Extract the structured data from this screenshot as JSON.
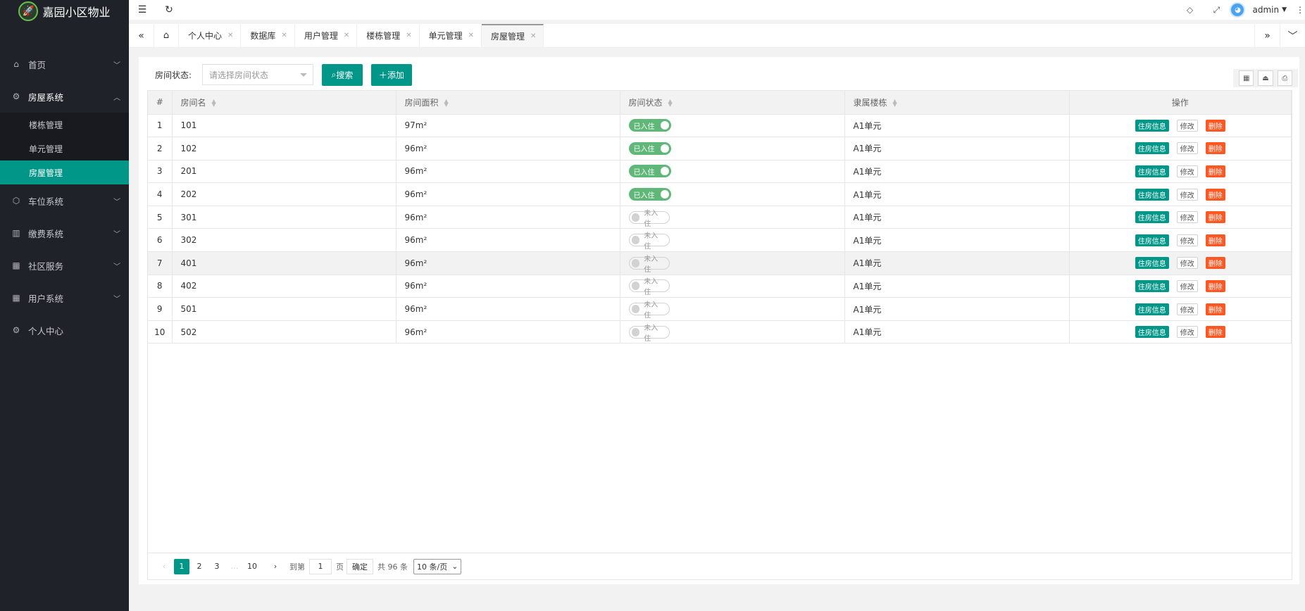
{
  "app": {
    "title": "嘉园小区物业"
  },
  "sidebar": {
    "items": [
      {
        "label": "首页",
        "icon": "home-icon",
        "arrow": "⌄"
      },
      {
        "label": "房屋系统",
        "icon": "gear-icon",
        "arrow": "⌃"
      },
      {
        "label": "车位系统",
        "icon": "cube-icon",
        "arrow": "⌄"
      },
      {
        "label": "缴费系统",
        "icon": "book-icon",
        "arrow": "⌄"
      },
      {
        "label": "社区服务",
        "icon": "apps-icon",
        "arrow": "⌄"
      },
      {
        "label": "用户系统",
        "icon": "apps-icon",
        "arrow": "⌄"
      },
      {
        "label": "个人中心",
        "icon": "gear-icon",
        "arrow": ""
      }
    ],
    "sub_items": [
      "楼栋管理",
      "单元管理",
      "房屋管理"
    ]
  },
  "header": {
    "user": "admin"
  },
  "tabs": [
    {
      "label": "个人中心"
    },
    {
      "label": "数据库"
    },
    {
      "label": "用户管理"
    },
    {
      "label": "楼栋管理"
    },
    {
      "label": "单元管理"
    },
    {
      "label": "房屋管理"
    }
  ],
  "filter": {
    "label": "房间状态:",
    "placeholder": "请选择房间状态",
    "search_label": "搜索",
    "add_label": "添加"
  },
  "table": {
    "columns": [
      "#",
      "房间名",
      "房间面积",
      "房间状态",
      "隶属楼栋",
      "操作"
    ],
    "rows": [
      {
        "no": "1",
        "name": "101",
        "area": "97m²",
        "status": "已入住",
        "occupied": true,
        "building": "A1单元"
      },
      {
        "no": "2",
        "name": "102",
        "area": "96m²",
        "status": "已入住",
        "occupied": true,
        "building": "A1单元"
      },
      {
        "no": "3",
        "name": "201",
        "area": "96m²",
        "status": "已入住",
        "occupied": true,
        "building": "A1单元"
      },
      {
        "no": "4",
        "name": "202",
        "area": "96m²",
        "status": "已入住",
        "occupied": true,
        "building": "A1单元"
      },
      {
        "no": "5",
        "name": "301",
        "area": "96m²",
        "status": "未入住",
        "occupied": false,
        "building": "A1单元"
      },
      {
        "no": "6",
        "name": "302",
        "area": "96m²",
        "status": "未入住",
        "occupied": false,
        "building": "A1单元"
      },
      {
        "no": "7",
        "name": "401",
        "area": "96m²",
        "status": "未入住",
        "occupied": false,
        "building": "A1单元"
      },
      {
        "no": "8",
        "name": "402",
        "area": "96m²",
        "status": "未入住",
        "occupied": false,
        "building": "A1单元"
      },
      {
        "no": "9",
        "name": "501",
        "area": "96m²",
        "status": "未入住",
        "occupied": false,
        "building": "A1单元"
      },
      {
        "no": "10",
        "name": "502",
        "area": "96m²",
        "status": "未入住",
        "occupied": false,
        "building": "A1单元"
      }
    ],
    "actions": {
      "info": "住房信息",
      "edit": "修改",
      "delete": "删除"
    }
  },
  "pager": {
    "pages": [
      "1",
      "2",
      "3",
      "…",
      "10"
    ],
    "goto_label": "到第",
    "goto_value": "1",
    "page_unit": "页",
    "confirm": "确定",
    "total": "共 96 条",
    "per_page": "10 条/页"
  },
  "colors": {
    "primary": "#009688",
    "sidebar": "#20222a",
    "danger": "#ff5722",
    "switch_on": "#5fb878"
  }
}
